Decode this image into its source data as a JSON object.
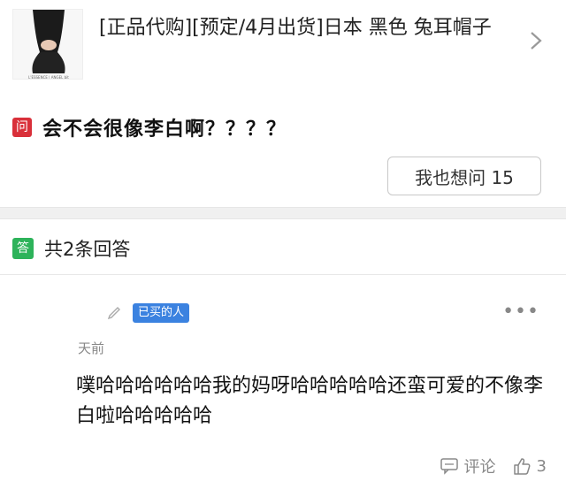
{
  "product": {
    "title": "[正品代购][预定/4月出货]日本 黑色 兔耳帽子",
    "image_caption": "L'ESSENCE | ANGEL bit"
  },
  "question": {
    "badge": "问",
    "text": "会不会很像李白啊？？？？"
  },
  "ask_button": {
    "label": "我也想问 15"
  },
  "answers_header": {
    "badge": "答",
    "count_text": "共2条回答"
  },
  "answer": {
    "buyer_badge": "已买的人",
    "time": "天前",
    "body": "噗哈哈哈哈哈哈我的妈呀哈哈哈哈哈还蛮可爱的不像李白啦哈哈哈哈哈",
    "comment_label": "评论",
    "like_count": "3"
  },
  "icons": [
    "chevron-right-icon",
    "pen-icon",
    "more-icon",
    "comment-icon",
    "thumbs-up-icon"
  ],
  "colors": {
    "question_badge": "#d9303a",
    "answer_badge": "#2db35a",
    "buyer_badge": "#3b82e0",
    "muted_text": "#888888"
  }
}
